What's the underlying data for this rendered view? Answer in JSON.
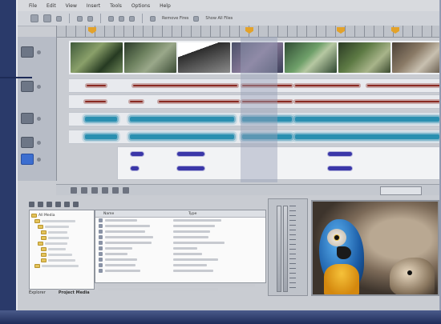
{
  "menubar": {
    "items": [
      "File",
      "Edit",
      "View",
      "Insert",
      "Tools",
      "Options",
      "Help"
    ]
  },
  "toolbar": {
    "remove_label": "Remove Fires",
    "show_all_label": "Show All Files"
  },
  "media_tree": {
    "root_label": "All Media"
  },
  "media_list": {
    "columns": [
      "Name",
      "Type"
    ]
  },
  "tabs": {
    "explorer": "Explorer",
    "project_media": "Project Media"
  },
  "colors": {
    "audio_red": "#8a2a22",
    "audio_teal": "#2a8fb0",
    "midi_purple": "#3a36a8",
    "marker_orange": "#e3a22a",
    "selection_blue": "#3c6ed0"
  },
  "icons": {
    "track_header": "track-header-icon",
    "folder": "folder-icon",
    "file": "file-icon"
  }
}
